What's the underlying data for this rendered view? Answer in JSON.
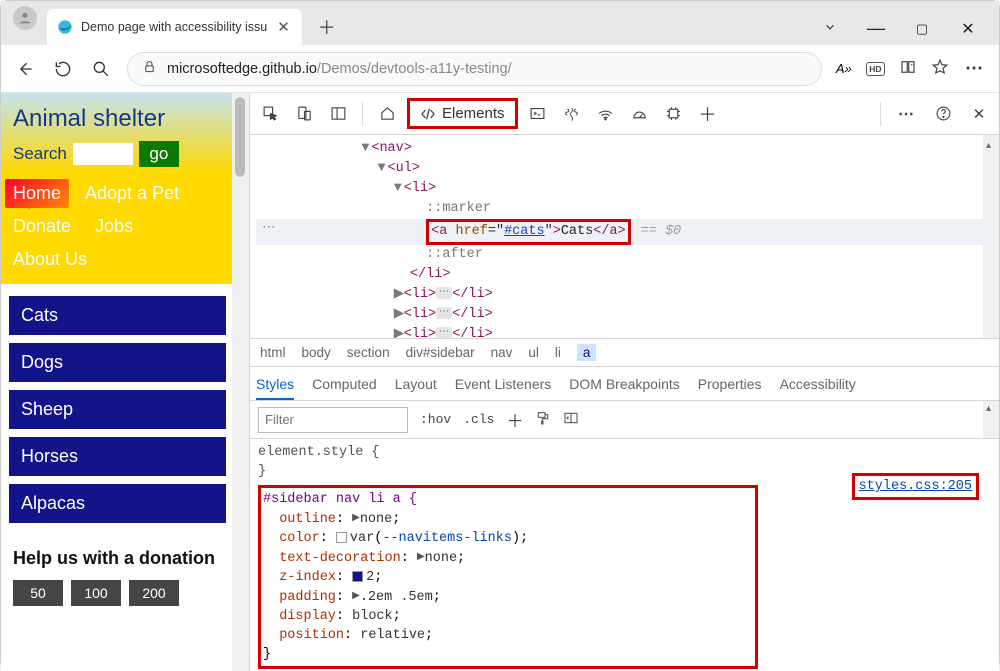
{
  "browser": {
    "tab_title": "Demo page with accessibility issu",
    "url_host": "microsoftedge.github.io",
    "url_path": "/Demos/devtools-a11y-testing/",
    "read_aloud": "A»",
    "hd": "HD"
  },
  "sidebar": {
    "title": "Animal shelter",
    "search_label": "Search",
    "go_label": "go",
    "nav": [
      "Home",
      "Adopt a Pet",
      "Donate",
      "Jobs",
      "About Us"
    ],
    "animals": [
      "Cats",
      "Dogs",
      "Sheep",
      "Horses",
      "Alpacas"
    ],
    "help_title": "Help us with a donation",
    "donations": [
      "50",
      "100",
      "200"
    ]
  },
  "devtools": {
    "elements_label": "Elements",
    "dom": {
      "nav": "nav",
      "ul": "ul",
      "li": "li",
      "marker": "::marker",
      "after": "::after",
      "a_tag": "a",
      "href_attr": "href",
      "href_val": "#cats",
      "a_text": "Cats",
      "eq": "== $0"
    },
    "breadcrumb": [
      "html",
      "body",
      "section",
      "div#sidebar",
      "nav",
      "ul",
      "li",
      "a"
    ],
    "styles_tabs": [
      "Styles",
      "Computed",
      "Layout",
      "Event Listeners",
      "DOM Breakpoints",
      "Properties",
      "Accessibility"
    ],
    "filter_placeholder": "Filter",
    "hov": ":hov",
    "cls": ".cls",
    "element_style": "element.style {",
    "rule_selector": "#sidebar nav li a {",
    "rules": {
      "outline": "outline",
      "outline_val": "none",
      "color": "color",
      "color_val": "var",
      "color_var": "--navitems-links",
      "textdec": "text-decoration",
      "textdec_val": "none",
      "zindex": "z-index",
      "zindex_val": "2",
      "padding": "padding",
      "padding_val": ".2em .5em",
      "display": "display",
      "display_val": "block",
      "position": "position",
      "position_val": "relative"
    },
    "source_link": "styles.css:205"
  }
}
